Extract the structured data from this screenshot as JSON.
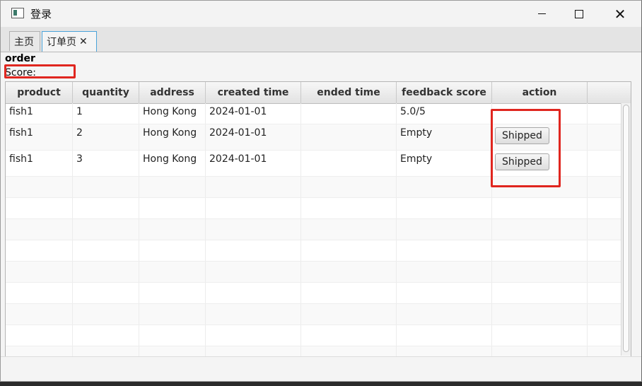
{
  "window": {
    "title": "登录"
  },
  "tabs": [
    {
      "label": "主页"
    },
    {
      "label": "订单页",
      "close": "✕"
    }
  ],
  "heading": "order",
  "score_label": "Score:",
  "table": {
    "columns": [
      "product",
      "quantity",
      "address",
      "created time",
      "ended time",
      "feedback score",
      "action"
    ],
    "rows": [
      {
        "product": "fish1",
        "quantity": "1",
        "address": "Hong Kong",
        "created": "2024-01-01",
        "ended": "",
        "feedback": "5.0/5",
        "action": ""
      },
      {
        "product": "fish1",
        "quantity": "2",
        "address": "Hong Kong",
        "created": "2024-01-01",
        "ended": "",
        "feedback": "Empty",
        "action": "Shipped"
      },
      {
        "product": "fish1",
        "quantity": "3",
        "address": "Hong Kong",
        "created": "2024-01-01",
        "ended": "",
        "feedback": "Empty",
        "action": "Shipped"
      }
    ]
  },
  "colors": {
    "highlight": "#e0261f",
    "active_tab_border": "#4aa3d9"
  }
}
